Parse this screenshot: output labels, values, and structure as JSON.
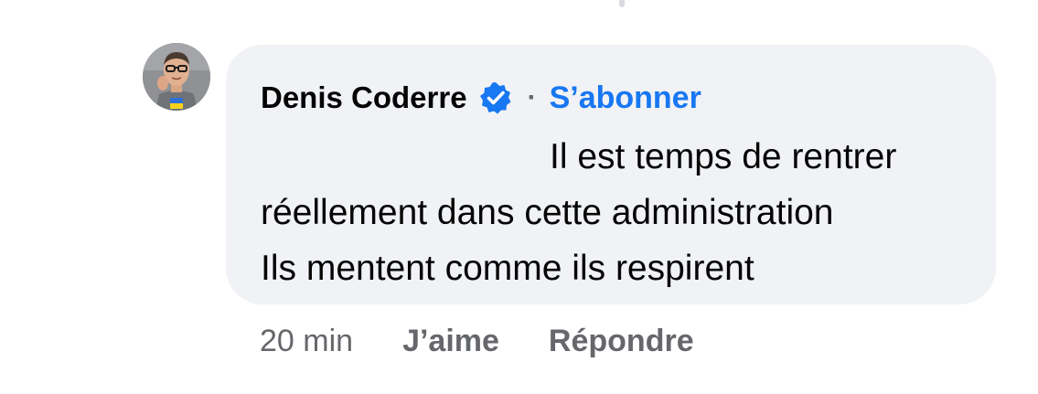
{
  "comment": {
    "author_name": "Denis Coderre",
    "verified_icon": "verified-badge-icon",
    "separator": "·",
    "follow_label": "S’abonner",
    "text_lines": [
      "Il est temps de rentrer",
      "réellement dans cette administration",
      "Ils mentent comme ils respirent"
    ],
    "timestamp": "20 min",
    "like_label": "J’aime",
    "reply_label": "Répondre"
  },
  "colors": {
    "bubble_background": "#f0f2f5",
    "link_blue": "#1877f2",
    "secondary_text": "#65676b",
    "primary_text": "#050505"
  }
}
